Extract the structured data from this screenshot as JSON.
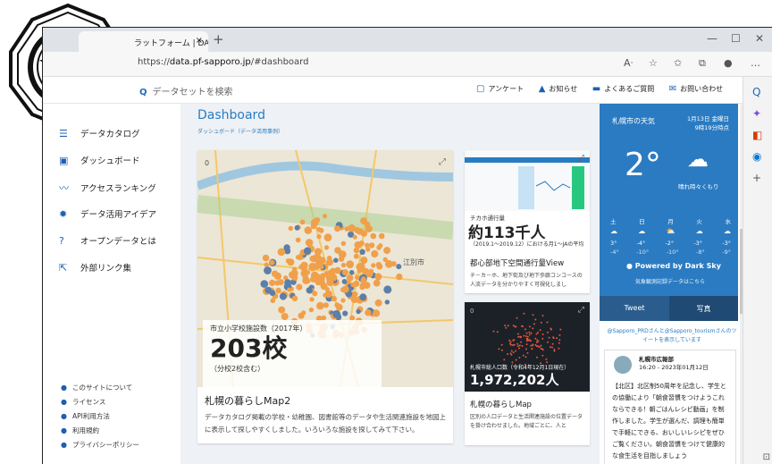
{
  "browser": {
    "tab_title": "ラットフォーム | DA",
    "tab_close": "×",
    "new_tab": "+",
    "url_prefix": "https://",
    "url_host": "data.pf-sapporo.jp",
    "url_path": "/#dashboard"
  },
  "topnav": {
    "search_placeholder": "データセットを検索",
    "links": [
      "アンケート",
      "お知らせ",
      "よくあるご質問",
      "お問い合わせ"
    ]
  },
  "sidebar": {
    "items": [
      "データカタログ",
      "ダッシュボード",
      "アクセスランキング",
      "データ活用アイデア",
      "オープンデータとは",
      "外部リンク集"
    ],
    "footer": [
      "このサイトについて",
      "ライセンス",
      "API利用方法",
      "利用規約",
      "プライバシーポリシー"
    ]
  },
  "dashboard": {
    "title": "Dashboard",
    "subtitle": "ダッシュボード（データ活用事例）"
  },
  "card_map2": {
    "stat_label": "市立小学校施設数（2017年）",
    "stat_value": "203校",
    "stat_sub": "（分校2校含む）",
    "title": "札幌の暮らしMap2",
    "desc": "データカタログ掲載の学校・幼稚園、図書館等のデータや生活関連施設を地図上に表示して探しやすくしました。いろいろな施設を探してみて下さい。",
    "like_count": "0",
    "map_label": "江別市"
  },
  "card_traffic": {
    "stat_label": "チカホ通行量",
    "stat_value": "約113千人",
    "stat_sub": "（2019.1～2019.12）における月1～JAの平均",
    "title": "都心部地下空間通行量View",
    "desc": "チ－カ－ホ、地下街及び地下歩廊コンコースの人流データを分かりやすく可視化しまし"
  },
  "card_population": {
    "stat_label": "札幌市総人口数（令和4年12月1日現在）",
    "stat_value": "1,972,202人",
    "title": "札幌の暮らしMap",
    "desc": "区別の人口データと生活関連施設の位置データを掛け合わせました。地域ごとに、人と",
    "like_count": "0"
  },
  "weather": {
    "title": "札幌市の天気",
    "date": "1月13日 金曜日",
    "time": "9時19分時点",
    "temp": "2°",
    "condition": "晴れ時々くもり",
    "days": [
      "土",
      "日",
      "月",
      "火",
      "水"
    ],
    "highs": [
      "3°",
      "-4°",
      "-2°",
      "-3°",
      "-3°"
    ],
    "lows": [
      "-4°",
      "-10°",
      "-10°",
      "-8°",
      "-9°"
    ],
    "powered": "Powered by Dark Sky",
    "credit": "気象観測記録データはこちら",
    "tweet_btn": "Tweet",
    "photo_btn": "写真",
    "tweet_info": "@Sapporo_PRDさんと@Sapporo_tourismさんのツイートを表示しています",
    "tweet_author": "札幌市広報部",
    "tweet_date": "16:20 - 2023年01月12日",
    "tweet_body": "【北区】北区制50周年を記念し、学生との協働により「朝食習慣をつけようこれならできる！朝ごはんレシピ動画」を制作しました。学生が選んだ、調理も簡単で手軽にできる、おいしいレシピをぜひご覧ください。朝食習慣をつけて健康的な食生活を目指しましょう"
  },
  "colors": {
    "accent": "#2b7bc2",
    "dots": "#f0a04b"
  }
}
